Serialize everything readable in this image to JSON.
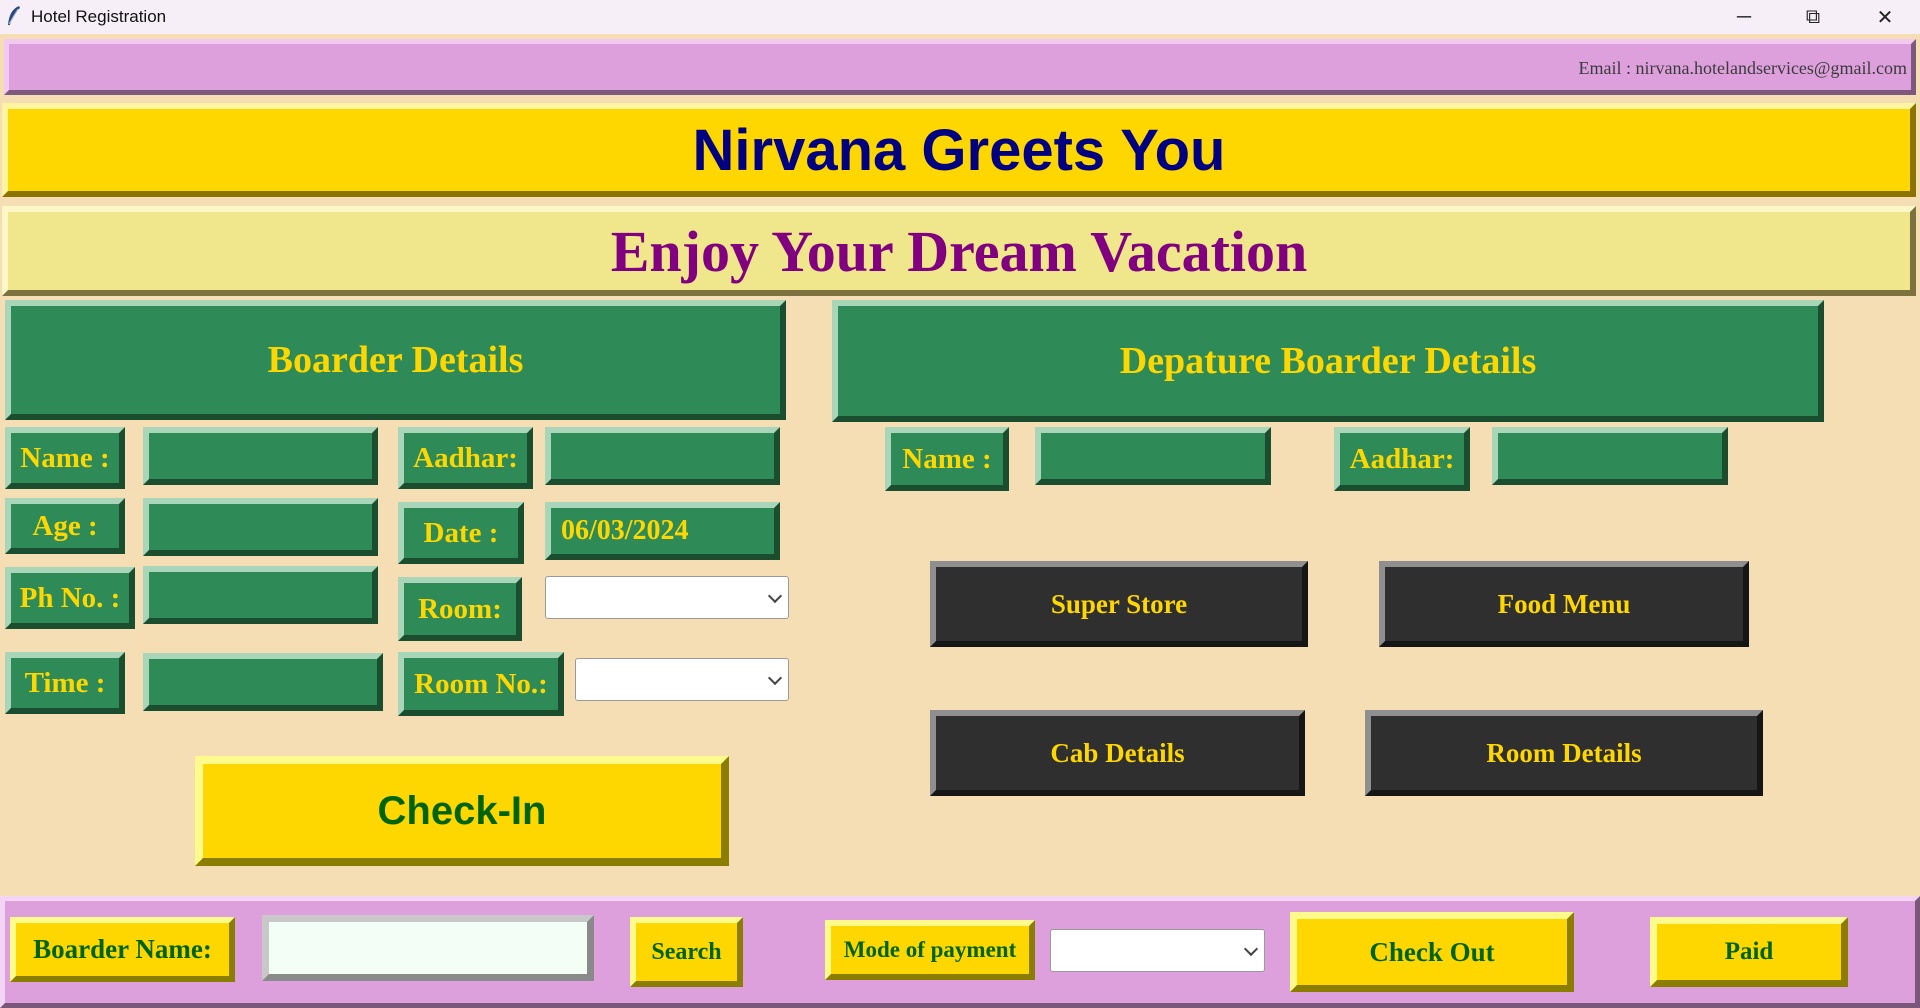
{
  "window": {
    "title": "Hotel Registration",
    "minimize_icon": "─",
    "restore_icon": "⧉",
    "close_icon": "✕"
  },
  "header": {
    "email": "Email : nirvana.hotelandservices@gmail.com",
    "greeting": "Nirvana Greets You",
    "tagline": "Enjoy Your Dream Vacation"
  },
  "boarder": {
    "title": "Boarder Details",
    "name_label": "Name :",
    "name_value": "",
    "age_label": "Age :",
    "age_value": "",
    "phone_label": "Ph No. :",
    "phone_value": "",
    "time_label": "Time :",
    "time_value": "",
    "aadhar_label": "Aadhar:",
    "aadhar_value": "",
    "date_label": "Date :",
    "date_value": "06/03/2024",
    "room_label": "Room:",
    "room_value": "",
    "room_no_label": "Room No.:",
    "room_no_value": "",
    "checkin_label": "Check-In"
  },
  "departure": {
    "title": "Depature Boarder Details",
    "name_label": "Name :",
    "name_value": "",
    "aadhar_label": "Aadhar:",
    "aadhar_value": ""
  },
  "services": {
    "super_store": "Super Store",
    "food_menu": "Food Menu",
    "cab_details": "Cab Details",
    "room_details": "Room Details"
  },
  "footer": {
    "boarder_name_label": "Boarder Name:",
    "boarder_name_value": "",
    "search_label": "Search",
    "payment_label": "Mode of payment",
    "payment_value": "",
    "checkout_label": "Check Out",
    "paid_label": "Paid"
  },
  "colors": {
    "background": "#f5deb3",
    "plum": "#dda0dd",
    "gold": "#ffd700",
    "khaki": "#f0e68c",
    "seagreen": "#2e8b57",
    "navy": "#000080",
    "purple": "#800080",
    "dark": "#2f2f2f"
  }
}
